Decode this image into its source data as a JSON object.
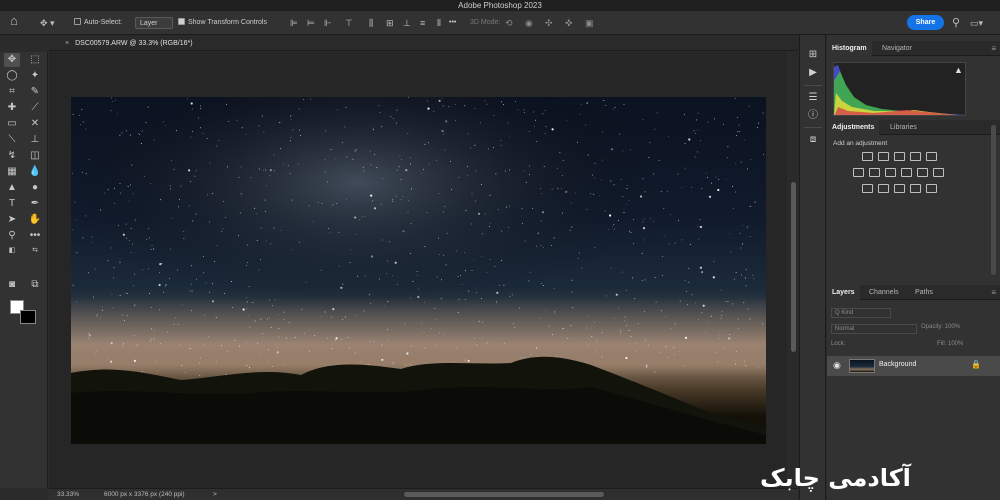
{
  "window": {
    "title": "Adobe Photoshop 2023"
  },
  "options_bar": {
    "home_icon": "home-icon",
    "move_tool_icon": "move-icon",
    "auto_select_label": "Auto-Select:",
    "auto_select_checked": false,
    "auto_select_target": "Layer",
    "show_transform_label": "Show Transform Controls",
    "show_transform_checked": true,
    "mode_3d_label": "3D Mode:",
    "share_label": "Share"
  },
  "document_tab": {
    "title": "DSC00579.ARW @ 33.3% (RGB/16*)"
  },
  "tools": [
    "move-icon",
    "artboard-icon",
    "lasso-icon",
    "magic-wand-icon",
    "crop-icon",
    "eyedropper-icon",
    "healing-icon",
    "brush-icon",
    "frame-icon",
    "clone-stamp-icon",
    "history-brush-icon",
    "eraser-icon",
    "gradient-icon",
    "blur-icon",
    "dodge-icon",
    "pen-icon",
    "type-icon",
    "path-select-icon",
    "shape-icon",
    "hand-icon",
    "zoom-icon",
    "more-tools-icon"
  ],
  "colors": {
    "foreground": "#ffffff",
    "background": "#000000",
    "accent": "#1473e6"
  },
  "status_bar": {
    "zoom": "33.33%",
    "doc_info": "6000 px x 3376 px (240 ppi)",
    "arrow": ">"
  },
  "panels": {
    "histogram_tabs": [
      "Histogram",
      "Navigator"
    ],
    "adjustments_tabs": [
      "Adjustments",
      "Libraries"
    ],
    "add_adjustment": "Add an adjustment",
    "layers_tabs": [
      "Layers",
      "Channels",
      "Paths"
    ],
    "layer_filter": "Q Kind",
    "blend_mode": "Normal",
    "opacity_label": "Opacity: 100%",
    "lock_label": "Lock:",
    "fill_label": "Fill: 100%",
    "layers": [
      {
        "name": "Background",
        "visible": true,
        "locked": true
      }
    ]
  },
  "watermark": {
    "text": "آکادمی چابک"
  }
}
